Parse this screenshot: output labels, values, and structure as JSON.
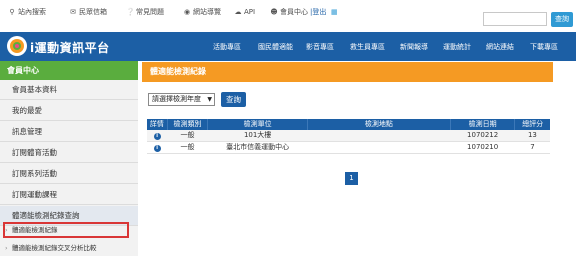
{
  "util_bar": {
    "links": [
      {
        "icon": "search-icon",
        "label": "站內搜索"
      },
      {
        "icon": "mail-icon",
        "label": "民眾信箱"
      },
      {
        "icon": "question-icon",
        "label": "常見問題"
      },
      {
        "icon": "globe-icon",
        "label": "網站導覽"
      },
      {
        "icon": "cloud-icon",
        "label": "API"
      },
      {
        "icon": "user-icon",
        "label": "會員中心"
      },
      {
        "icon": "logout-link",
        "label": "|登出"
      }
    ],
    "search_placeholder": "",
    "search_button": "查詢"
  },
  "header": {
    "logo_text": "i運動資訊平台",
    "nav": [
      "活動專區",
      "國民體適能",
      "影音專區",
      "救生員專區",
      "新聞報導",
      "運動統計",
      "網站連結",
      "下載專區"
    ]
  },
  "sidebar": {
    "title": "會員中心",
    "items": [
      "會員基本資料",
      "我的最愛",
      "訊息管理",
      "訂閱體育活動",
      "訂閱系列活動",
      "訂閱運動課程",
      "體適能檢測紀錄查詢"
    ],
    "subitems": [
      "體適能檢測紀錄",
      "體適能檢測紀錄交叉分析比較"
    ]
  },
  "content": {
    "title": "體適能檢測紀錄",
    "select_value": "請選擇檢測年度",
    "query_button": "查詢",
    "table": {
      "headers": [
        "詳情",
        "檢測類別",
        "檢測單位",
        "檢測地點",
        "檢測日期",
        "總評分"
      ],
      "rows": [
        [
          "一般",
          "101大樓",
          "",
          "1070212",
          "13"
        ],
        [
          "一般",
          "臺北市信義運動中心",
          "",
          "1070210",
          "7"
        ]
      ]
    },
    "pager": {
      "current": "1"
    }
  },
  "colors": {
    "brand_blue": "#1c5fa5",
    "sidebar_green": "#5aad3e",
    "content_orange": "#f59a23",
    "highlight_red": "#d93636"
  }
}
